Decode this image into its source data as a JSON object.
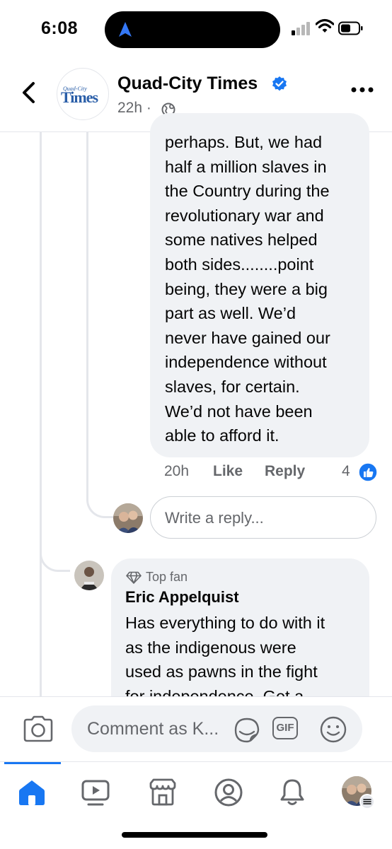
{
  "status_bar": {
    "time": "6:08"
  },
  "header": {
    "logo": {
      "small": "Quad-City",
      "big": "Times"
    },
    "page_name": "Quad-City Times",
    "time_ago": "22h ·"
  },
  "reply_comment": {
    "text": "perhaps.  But, we had\nhalf a million slaves in\nthe Country during the\nrevolutionary war and\nsome natives helped\nboth sides........point\nbeing, they were a big\npart as well.  We’d\nnever have gained our\nindependence without\nslaves, for certain.\nWe’d not have been\nable to afford it.",
    "time": "20h",
    "like_label": "Like",
    "reply_label": "Reply",
    "reaction_count": "4"
  },
  "write_reply": {
    "placeholder": "Write a reply..."
  },
  "comment2": {
    "badge": "Top fan",
    "author": "Eric Appelquist",
    "text": "Has everything to do with it\nas the indigenous were\nused as pawns in the fight\nfor independence. Get a"
  },
  "composer": {
    "placeholder": "Comment as K...",
    "gif_label": "GIF"
  },
  "tabs": [
    "home-icon",
    "video-icon",
    "marketplace-icon",
    "profile-icon",
    "bell-icon",
    "menu-avatar"
  ],
  "colors": {
    "accent": "#1877f2",
    "bubble": "#f0f2f5",
    "secondary_text": "#65676b"
  }
}
